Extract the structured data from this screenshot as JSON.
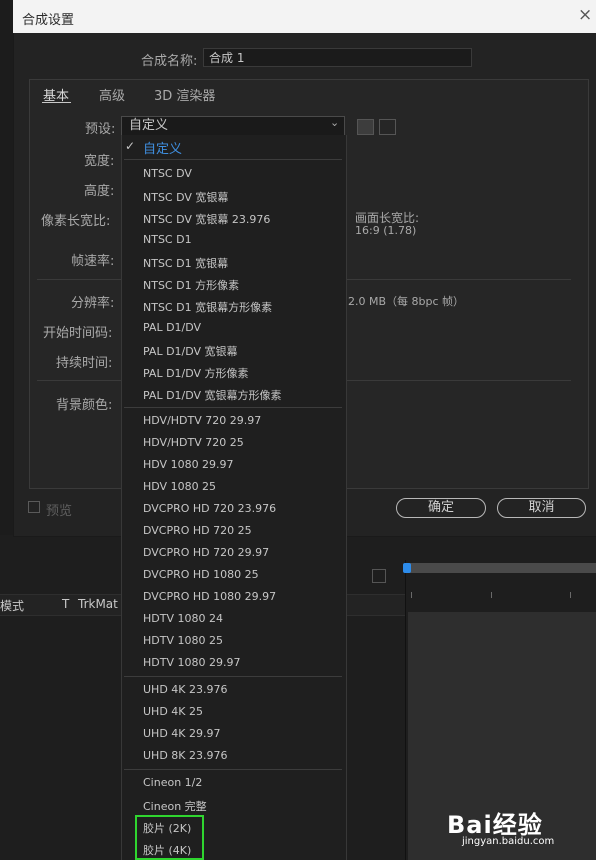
{
  "dialog": {
    "title": "合成设置",
    "close_symbol": "×",
    "name_label": "合成名称:",
    "name_value": "合成 1",
    "tabs": [
      {
        "label": "基本"
      },
      {
        "label": "高级"
      },
      {
        "label": "3D 渲染器"
      }
    ],
    "labels": {
      "preset": "预设:",
      "width": "宽度:",
      "height": "高度:",
      "pixel_aspect": "像素长宽比:",
      "frame_aspect": "画面长宽比:",
      "frame_aspect_value": "16:9 (1.78)",
      "frame_rate": "帧速率:",
      "resolution": "分辨率:",
      "resolution_info": "2.0 MB（每 8bpc 帧）",
      "start_timecode": "开始时间码:",
      "duration": "持续时间:",
      "bg_color": "背景颜色:"
    },
    "preset_value": "自定义",
    "preview_label": "预览",
    "ok_label": "确定",
    "cancel_label": "取消"
  },
  "dropdown": {
    "selected": "自定义",
    "items": [
      "NTSC DV",
      "NTSC DV 宽银幕",
      "NTSC DV 宽银幕 23.976",
      "NTSC D1",
      "NTSC D1 宽银幕",
      "NTSC D1 方形像素",
      "NTSC D1 宽银幕方形像素",
      "PAL D1/DV",
      "PAL D1/DV 宽银幕",
      "PAL D1/DV 方形像素",
      "PAL D1/DV 宽银幕方形像素",
      "HDV/HDTV 720 29.97",
      "HDV/HDTV 720 25",
      "HDV 1080 29.97",
      "HDV 1080 25",
      "DVCPRO HD 720 23.976",
      "DVCPRO HD 720 25",
      "DVCPRO HD 720 29.97",
      "DVCPRO HD 1080 25",
      "DVCPRO HD 1080 29.97",
      "HDTV 1080 24",
      "HDTV 1080 25",
      "HDTV 1080 29.97",
      "UHD 4K 23.976",
      "UHD 4K 25",
      "UHD 4K 29.97",
      "UHD 8K 23.976",
      "Cineon 1/2",
      "Cineon 完整",
      "胶片 (2K)",
      "胶片 (4K)"
    ]
  },
  "background": {
    "col_mode": "模式",
    "col_t": "T",
    "col_trkmat": "TrkMat"
  },
  "watermark": {
    "brand": "Bai经验",
    "url": "jingyan.baidu.com"
  },
  "colors": {
    "accent": "#3f8fe0",
    "highlight": "#2fd52f"
  }
}
